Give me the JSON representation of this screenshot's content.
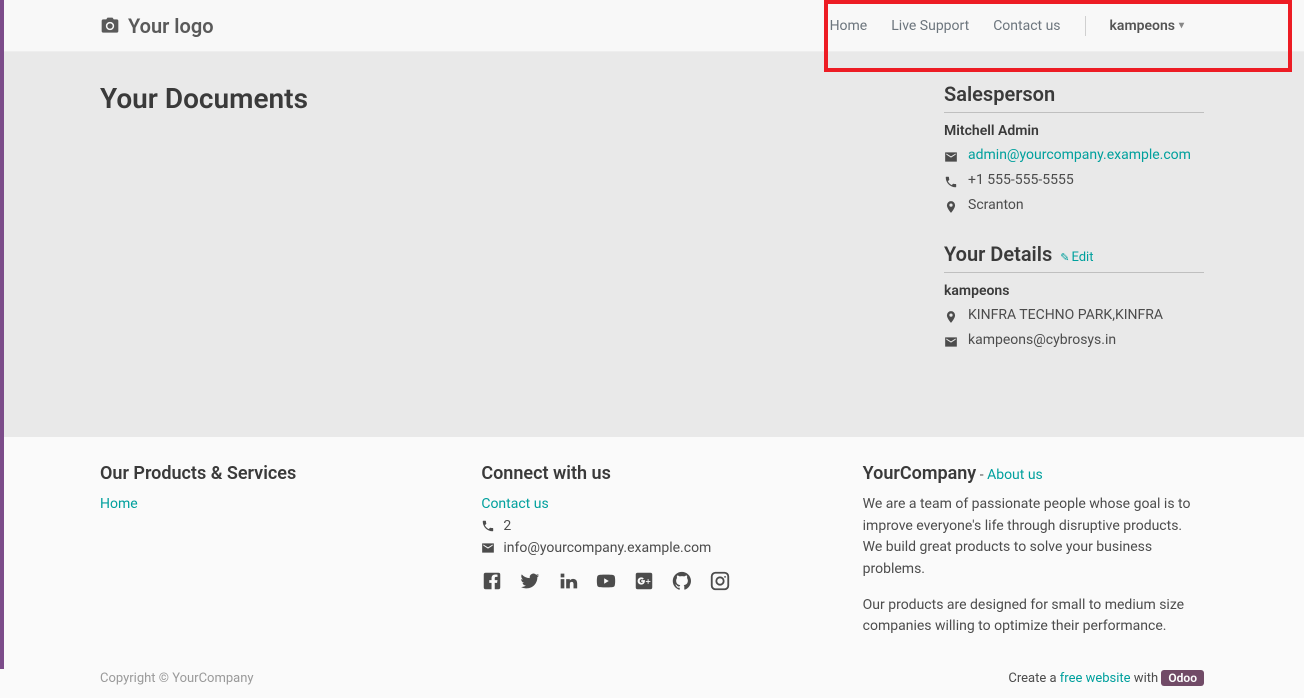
{
  "nav": {
    "logo_text": "Your logo",
    "items": [
      "Home",
      "Live Support",
      "Contact us"
    ],
    "user": "kampeons"
  },
  "main": {
    "title": "Your Documents"
  },
  "salesperson": {
    "heading": "Salesperson",
    "name": "Mitchell Admin",
    "email": "admin@yourcompany.example.com",
    "phone": "+1 555-555-5555",
    "city": "Scranton"
  },
  "details": {
    "heading": "Your Details",
    "edit_label": "Edit",
    "name": "kampeons",
    "address": "KINFRA TECHNO PARK,KINFRA",
    "email": "kampeons@cybrosys.in"
  },
  "footer": {
    "products": {
      "heading": "Our Products & Services",
      "links": [
        "Home"
      ]
    },
    "connect": {
      "heading": "Connect with us",
      "contact_link": "Contact us",
      "phone": "2",
      "email": "info@yourcompany.example.com"
    },
    "company": {
      "name": "YourCompany",
      "about_label": "About us",
      "desc1": "We are a team of passionate people whose goal is to improve everyone's life through disruptive products. We build great products to solve your business problems.",
      "desc2": "Our products are designed for small to medium size companies willing to optimize their performance."
    },
    "copyright": "Copyright © YourCompany",
    "odoo": {
      "prefix": "Create a ",
      "link": "free website",
      "mid": " with ",
      "badge": "Odoo"
    }
  }
}
